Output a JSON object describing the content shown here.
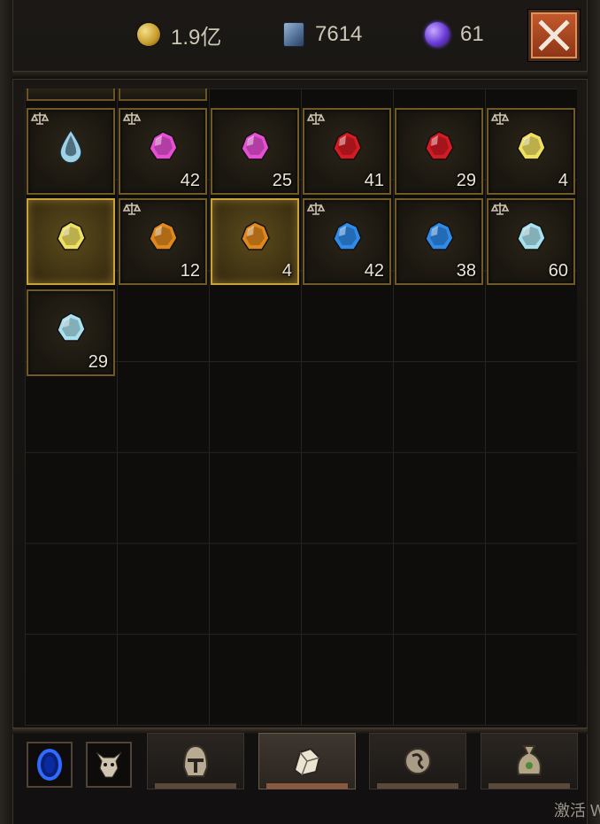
{
  "currencies": [
    {
      "icon": "gold-coin-icon",
      "value": "1.9亿"
    },
    {
      "icon": "scroll-icon",
      "value": "7614"
    },
    {
      "icon": "purple-orb-icon",
      "value": "61"
    }
  ],
  "watermark": "激活 W",
  "inventory": {
    "slots": [
      {
        "gem": "diamond-teardrop",
        "color": "#9fd3e6",
        "count": "",
        "locked": true,
        "selected": false
      },
      {
        "gem": "amethyst",
        "color": "#e64fd2",
        "count": "42",
        "locked": true,
        "selected": false
      },
      {
        "gem": "amethyst",
        "color": "#e64fd2",
        "count": "25",
        "locked": false,
        "selected": false
      },
      {
        "gem": "ruby",
        "color": "#d41a22",
        "count": "41",
        "locked": true,
        "selected": false
      },
      {
        "gem": "ruby",
        "color": "#d41a22",
        "count": "29",
        "locked": false,
        "selected": false
      },
      {
        "gem": "topaz",
        "color": "#f0e060",
        "count": "4",
        "locked": true,
        "selected": false
      },
      {
        "gem": "topaz",
        "color": "#f0e060",
        "count": "",
        "locked": false,
        "selected": true
      },
      {
        "gem": "amber",
        "color": "#e0881c",
        "count": "12",
        "locked": true,
        "selected": false
      },
      {
        "gem": "amber",
        "color": "#e0881c",
        "count": "4",
        "locked": false,
        "selected": true
      },
      {
        "gem": "sapphire",
        "color": "#2f8ae8",
        "count": "42",
        "locked": true,
        "selected": false
      },
      {
        "gem": "sapphire",
        "color": "#2f8ae8",
        "count": "38",
        "locked": false,
        "selected": false
      },
      {
        "gem": "diamond",
        "color": "#a8e0ee",
        "count": "60",
        "locked": true,
        "selected": false
      },
      {
        "gem": "diamond",
        "color": "#a8e0ee",
        "count": "29",
        "locked": false,
        "selected": false
      }
    ]
  },
  "bottom": {
    "sort_buttons": [
      {
        "icon": "blue-portal-icon"
      },
      {
        "icon": "demon-head-icon"
      }
    ],
    "tabs": [
      {
        "icon": "helmet-icon",
        "active": false
      },
      {
        "icon": "gem-tab-icon",
        "active": true
      },
      {
        "icon": "rune-icon",
        "active": false
      },
      {
        "icon": "pouch-icon",
        "active": false
      }
    ]
  }
}
